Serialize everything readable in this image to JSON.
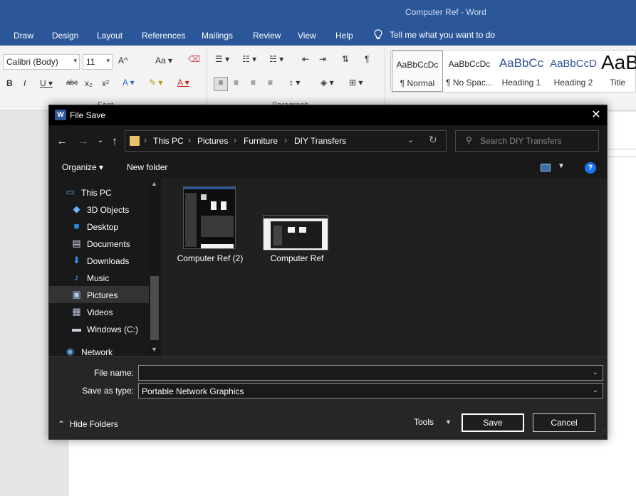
{
  "word": {
    "doc_title": "Computer Ref  -  Word",
    "tabs": [
      "Draw",
      "Design",
      "Layout",
      "References",
      "Mailings",
      "Review",
      "View",
      "Help"
    ],
    "tell_me": "Tell me what you want to do",
    "font_name": "Calibri (Body)",
    "font_size": "11",
    "group_font": "Font",
    "group_paragraph": "Paragraph",
    "styles": [
      {
        "sample": "AaBbCcDc",
        "name": "¶ Normal"
      },
      {
        "sample": "AaBbCcDc",
        "name": "¶ No Spac..."
      },
      {
        "sample": "AaBbCc",
        "name": "Heading 1"
      },
      {
        "sample": "AaBbCcD",
        "name": "Heading 2"
      },
      {
        "sample": "AaB",
        "name": "Title"
      }
    ],
    "colors": {
      "brand": "#2b579a",
      "heading": "#2f5496"
    }
  },
  "dialog": {
    "title": "File Save",
    "close_glyph": "✕",
    "breadcrumb": [
      "This PC",
      "Pictures",
      "Furniture",
      "DIY Transfers"
    ],
    "search_placeholder": "Search DIY Transfers",
    "organize_label": "Organize",
    "new_folder_label": "New folder",
    "help_glyph": "?",
    "nav_items": [
      {
        "label": "This PC",
        "icon": "computer-icon"
      },
      {
        "label": "3D Objects",
        "icon": "cube-icon"
      },
      {
        "label": "Desktop",
        "icon": "desktop-icon"
      },
      {
        "label": "Documents",
        "icon": "documents-icon"
      },
      {
        "label": "Downloads",
        "icon": "download-icon"
      },
      {
        "label": "Music",
        "icon": "music-icon"
      },
      {
        "label": "Pictures",
        "icon": "pictures-icon"
      },
      {
        "label": "Videos",
        "icon": "video-icon"
      },
      {
        "label": "Windows (C:)",
        "icon": "drive-icon"
      },
      {
        "label": "Network",
        "icon": "network-icon"
      }
    ],
    "selected_nav": "Pictures",
    "files": [
      {
        "name": "Computer Ref (2)"
      },
      {
        "name": "Computer Ref"
      }
    ],
    "file_name_label": "File name:",
    "file_name_value": "",
    "save_as_type_label": "Save as type:",
    "save_as_type_value": "Portable Network Graphics",
    "hide_folders_label": "Hide Folders",
    "tools_label": "Tools",
    "save_label": "Save",
    "cancel_label": "Cancel"
  }
}
